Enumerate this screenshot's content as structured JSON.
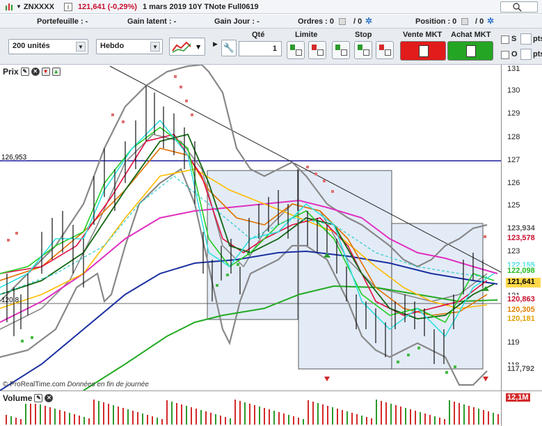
{
  "title": {
    "symbol": "ZNXXXX",
    "price": "121,641 (-0,29%)",
    "info": "1 mars 2019 10Y TNote Full0619"
  },
  "status": {
    "portefeuille": "Portefeuille : -",
    "gain_latent": "Gain latent : -",
    "gain_jour": "Gain Jour : -",
    "ordres_label": "Ordres : 0",
    "ordres_count": "/ 0",
    "position_label": "Position : 0",
    "position_count": "/ 0"
  },
  "toolbar": {
    "units": "200 unités",
    "period": "Hebdo",
    "qte_label": "Qté",
    "qte_value": "1",
    "limite_label": "Limite",
    "stop_label": "Stop",
    "vente_label": "Vente MKT",
    "achat_label": "Achat MKT",
    "s_label": "S",
    "o_label": "O",
    "pts": "pts"
  },
  "chart": {
    "panel_title": "Prix",
    "hline_label": "126,953",
    "hline2_label": "120,8",
    "watermark": "© ProRealTime.com",
    "watermark_note": "Données en fin de journée",
    "ticks": [
      "131",
      "130",
      "129",
      "128",
      "127",
      "126",
      "125",
      "124",
      "123",
      "122",
      "121",
      "120",
      "119",
      "118"
    ],
    "price_labels": [
      {
        "text": "123,934",
        "color": "#555555",
        "bg": "#ffffff"
      },
      {
        "text": "123,578",
        "color": "#c8102e",
        "bg": "#ffffff"
      },
      {
        "text": "122,155",
        "color": "#55e0e0",
        "bg": "#ffffff"
      },
      {
        "text": "122,098",
        "color": "#22bb22",
        "bg": "#ffffff"
      },
      {
        "text": "121,641",
        "color": "#000000",
        "bg": "#ffd84a"
      },
      {
        "text": "120,863",
        "color": "#c8102e",
        "bg": "#ffffff"
      },
      {
        "text": "120,305",
        "color": "#e08000",
        "bg": "#ffffff"
      },
      {
        "text": "120,181",
        "color": "#e0a000",
        "bg": "#ffffff"
      },
      {
        "text": "117,792",
        "color": "#555555",
        "bg": "#ffffff"
      }
    ]
  },
  "volume": {
    "panel_title": "Volume",
    "value": "12,1M"
  }
}
